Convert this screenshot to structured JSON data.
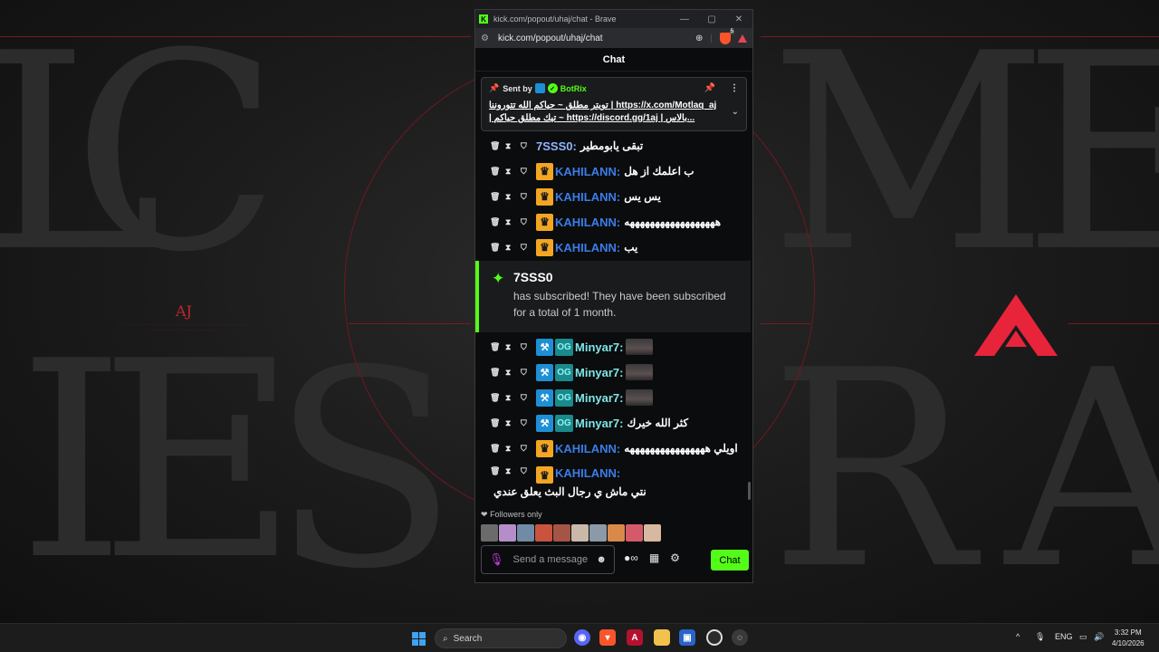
{
  "window": {
    "title": "kick.com/popout/uhaj/chat - Brave",
    "url": "kick.com/popout/uhaj/chat",
    "shield_count": "5"
  },
  "chat": {
    "header": "Chat",
    "pinned": {
      "sent_by_label": "Sent by",
      "bot_name": "BotRix",
      "message": "تويتر مطلق ~ حياكم الله تتوروننا | https://x.com/Motlaq_aj | تيك مطلق حياكم ~ https://discord.gg/1aj | بالاس..."
    },
    "messages_top": [
      {
        "user": "7SSS0",
        "color": "#8fb4ff",
        "badges": [],
        "text": "تبقى يابومطير"
      },
      {
        "user": "KAHILANN",
        "color": "#3b7de8",
        "badges": [
          "crown"
        ],
        "text": "ب اعلمك از هل"
      },
      {
        "user": "KAHILANN",
        "color": "#3b7de8",
        "badges": [
          "crown"
        ],
        "text": "يس يس"
      },
      {
        "user": "KAHILANN",
        "color": "#3b7de8",
        "badges": [
          "crown"
        ],
        "text": "ههههههههههههههههههه"
      },
      {
        "user": "KAHILANN",
        "color": "#3b7de8",
        "badges": [
          "crown"
        ],
        "text": "يب"
      }
    ],
    "subscription": {
      "user": "7SSS0",
      "text": "has subscribed! They have been subscribed for a total of 1 month."
    },
    "messages_bottom": [
      {
        "user": "Minyar7",
        "color": "#7ee6e8",
        "badges": [
          "tool",
          "og"
        ],
        "text": "",
        "emote": true
      },
      {
        "user": "Minyar7",
        "color": "#7ee6e8",
        "badges": [
          "tool",
          "og"
        ],
        "text": "",
        "emote": true
      },
      {
        "user": "Minyar7",
        "color": "#7ee6e8",
        "badges": [
          "tool",
          "og"
        ],
        "text": "",
        "emote": true
      },
      {
        "user": "Minyar7",
        "color": "#7ee6e8",
        "badges": [
          "tool",
          "og"
        ],
        "text": "كثر الله خيرك"
      },
      {
        "user": "KAHILANN",
        "color": "#3b7de8",
        "badges": [
          "crown"
        ],
        "text": "اويلي ههههههههههههههههه"
      },
      {
        "user": "KAHILANN",
        "color": "#3b7de8",
        "badges": [
          "crown"
        ],
        "text": "نتي ماش ي رجال البث يعلق عندي"
      }
    ],
    "followers_only": "Followers only",
    "input_placeholder": "Send a message",
    "send_label": "Chat"
  },
  "taskbar": {
    "search_label": "Search",
    "language": "ENG",
    "time": "3:32 PM",
    "date": "4/10/2026"
  },
  "colors": {
    "kick_green": "#53fc18",
    "crown_badge": "#f3a623",
    "accent_red": "#e8243b"
  }
}
